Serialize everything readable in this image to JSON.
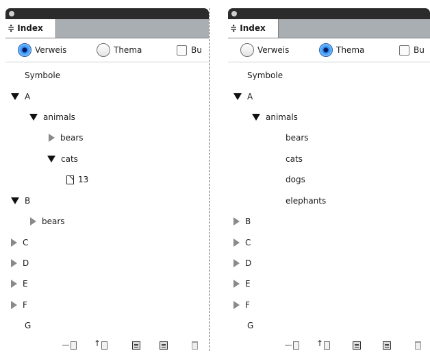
{
  "left": {
    "tab": "Index",
    "options": [
      {
        "label": "Verweis",
        "kind": "radio",
        "selected": true
      },
      {
        "label": "Thema",
        "kind": "radio",
        "selected": false
      },
      {
        "label": "Bu",
        "kind": "checkbox",
        "selected": false
      }
    ],
    "tree": [
      {
        "label": "Symbole",
        "level": 0,
        "state": "none"
      },
      {
        "label": "A",
        "level": 0,
        "state": "expanded"
      },
      {
        "label": "animals",
        "level": 1,
        "state": "expanded"
      },
      {
        "label": "bears",
        "level": 2,
        "state": "collapsed"
      },
      {
        "label": "cats",
        "level": 2,
        "state": "expanded"
      },
      {
        "label": "13",
        "level": 3,
        "state": "page"
      },
      {
        "label": "B",
        "level": 0,
        "state": "expanded"
      },
      {
        "label": "bears",
        "level": 1,
        "state": "collapsed"
      },
      {
        "label": "C",
        "level": 0,
        "state": "collapsed"
      },
      {
        "label": "D",
        "level": 0,
        "state": "collapsed"
      },
      {
        "label": "E",
        "level": 0,
        "state": "collapsed"
      },
      {
        "label": "F",
        "level": 0,
        "state": "collapsed"
      },
      {
        "label": "G",
        "level": 0,
        "state": "none"
      }
    ]
  },
  "right": {
    "tab": "Index",
    "options": [
      {
        "label": "Verweis",
        "kind": "radio",
        "selected": false
      },
      {
        "label": "Thema",
        "kind": "radio",
        "selected": true
      },
      {
        "label": "Bu",
        "kind": "checkbox",
        "selected": false
      }
    ],
    "tree": [
      {
        "label": "Symbole",
        "level": 0,
        "state": "none"
      },
      {
        "label": "A",
        "level": 0,
        "state": "expanded"
      },
      {
        "label": "animals",
        "level": 1,
        "state": "expanded"
      },
      {
        "label": "bears",
        "level": 2,
        "state": "plain"
      },
      {
        "label": "cats",
        "level": 2,
        "state": "plain"
      },
      {
        "label": "dogs",
        "level": 2,
        "state": "plain"
      },
      {
        "label": "elephants",
        "level": 2,
        "state": "plain"
      },
      {
        "label": "B",
        "level": 0,
        "state": "collapsed"
      },
      {
        "label": "C",
        "level": 0,
        "state": "collapsed"
      },
      {
        "label": "D",
        "level": 0,
        "state": "collapsed"
      },
      {
        "label": "E",
        "level": 0,
        "state": "collapsed"
      },
      {
        "label": "F",
        "level": 0,
        "state": "collapsed"
      },
      {
        "label": "G",
        "level": 0,
        "state": "none"
      }
    ]
  },
  "toolbar_icons": [
    "go-to-selected-marker-icon",
    "update-preview-icon",
    "generate-index-icon",
    "new-entry-icon",
    "delete-icon"
  ]
}
